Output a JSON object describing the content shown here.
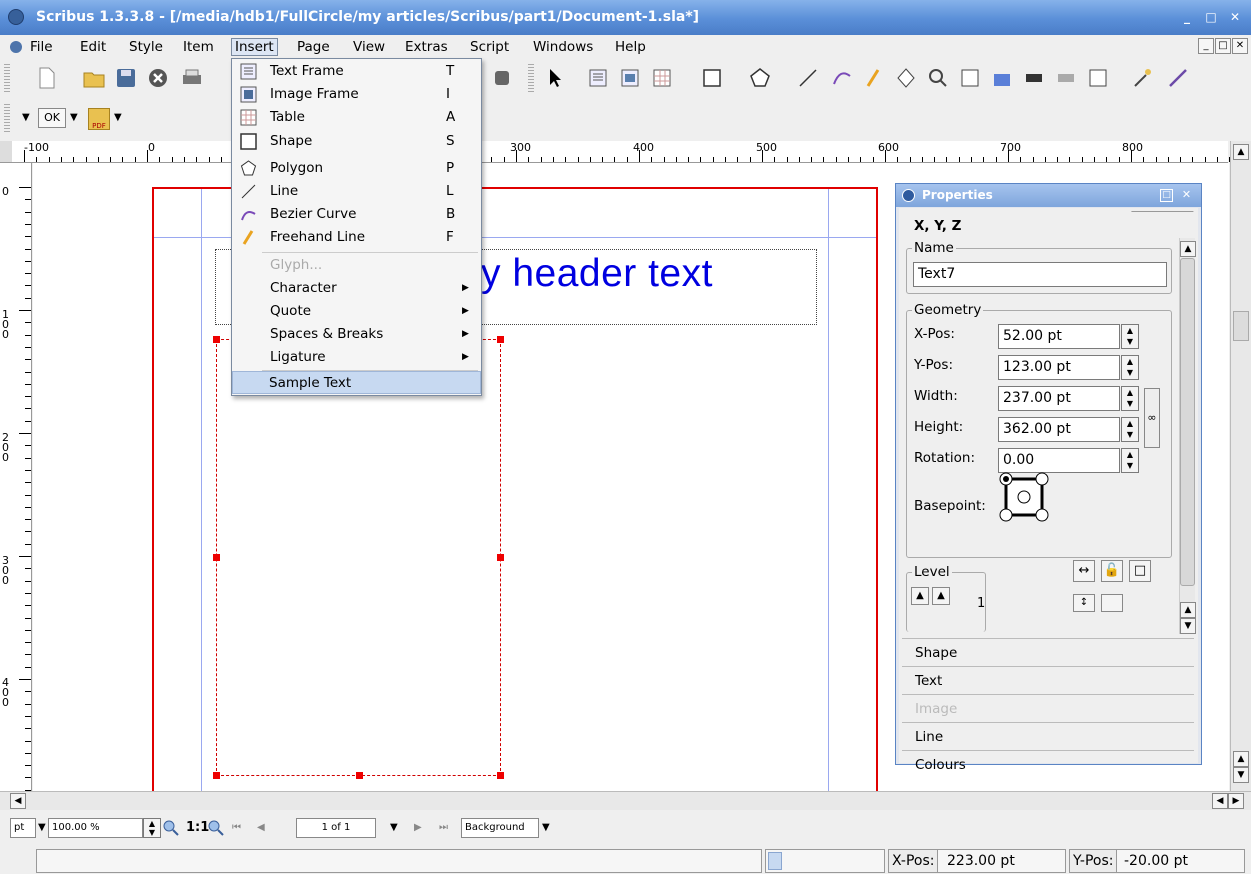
{
  "window": {
    "title": "Scribus 1.3.3.8 - [/media/hdb1/FullCircle/my articles/Scribus/part1/Document-1.sla*]"
  },
  "menubar": {
    "items": [
      {
        "label": "File",
        "u": "F"
      },
      {
        "label": "Edit"
      },
      {
        "label": "Style"
      },
      {
        "label": "Item"
      },
      {
        "label": "Insert"
      },
      {
        "label": "Page"
      },
      {
        "label": "View"
      },
      {
        "label": "Extras"
      },
      {
        "label": "Script"
      },
      {
        "label": "Windows"
      },
      {
        "label": "Help"
      }
    ]
  },
  "toolbar": {
    "pdf_label": "PDF",
    "ok_label": "OK"
  },
  "insert_menu": {
    "items": [
      {
        "label": "Text Frame",
        "shortcut": "T",
        "icon": "text-frame-icon"
      },
      {
        "label": "Image Frame",
        "shortcut": "I",
        "icon": "image-frame-icon"
      },
      {
        "label": "Table",
        "shortcut": "A",
        "icon": "table-icon"
      },
      {
        "label": "Shape",
        "shortcut": "S",
        "icon": "shape-icon"
      },
      {
        "label": "Polygon",
        "shortcut": "P",
        "icon": "polygon-icon"
      },
      {
        "label": "Line",
        "shortcut": "L",
        "icon": "line-icon"
      },
      {
        "label": "Bezier Curve",
        "shortcut": "B",
        "icon": "bezier-curve-icon"
      },
      {
        "label": "Freehand Line",
        "shortcut": "F",
        "icon": "freehand-line-icon"
      },
      {
        "label": "Glyph...",
        "disabled": true
      },
      {
        "label": "Character",
        "submenu": true
      },
      {
        "label": "Quote",
        "submenu": true
      },
      {
        "label": "Spaces & Breaks",
        "submenu": true
      },
      {
        "label": "Ligature",
        "submenu": true
      },
      {
        "label": "Sample Text",
        "selected": true
      }
    ]
  },
  "ruler": {
    "h_labels": [
      "-100",
      "0",
      "100",
      "200",
      "300",
      "400",
      "500",
      "600",
      "700",
      "800"
    ],
    "v_labels": [
      "0",
      "1\n0\n0",
      "2\n0\n0",
      "3\n0\n0",
      "4\n0\n0"
    ]
  },
  "canvas": {
    "header_text": "My header text"
  },
  "properties": {
    "title": "Properties",
    "tab_xyz": "X, Y, Z",
    "name_group": "Name",
    "name_value": "Text7",
    "geometry_group": "Geometry",
    "xpos_label": "X-Pos:",
    "xpos_value": "52.00 pt",
    "ypos_label": "Y-Pos:",
    "ypos_value": "123.00 pt",
    "width_label": "Width:",
    "width_value": "237.00 pt",
    "height_label": "Height:",
    "height_value": "362.00 pt",
    "rotation_label": "Rotation:",
    "rotation_value": "0.00",
    "basepoint_label": "Basepoint:",
    "level_group": "Level",
    "level_value": "1",
    "tabs": [
      {
        "label": "Shape"
      },
      {
        "label": "Text"
      },
      {
        "label": "Image",
        "disabled": true
      },
      {
        "label": "Line"
      },
      {
        "label": "Colours"
      }
    ]
  },
  "bottombar": {
    "unit": "pt",
    "zoom": "100.00 %",
    "zoom_one_to_one": "1:1",
    "page_indicator": "1 of 1",
    "layer": "Background"
  },
  "statusbar": {
    "xpos_label": "X-Pos:",
    "xpos_value": "223.00 pt",
    "ypos_label": "Y-Pos:",
    "ypos_value": "-20.00 pt"
  }
}
